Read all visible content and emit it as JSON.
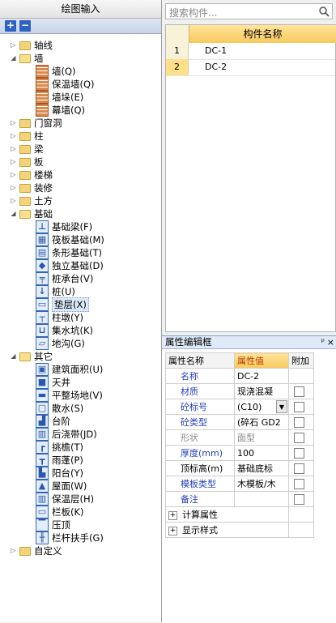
{
  "left_panel": {
    "title": "绘图输入",
    "toolbar": {
      "expand": "+",
      "collapse": "−"
    },
    "tree": [
      {
        "label": "轴线",
        "level": 0,
        "kind": "folder",
        "expanded": false
      },
      {
        "label": "墙",
        "level": 0,
        "kind": "folder",
        "expanded": true
      },
      {
        "label": "墙(Q)",
        "level": 1,
        "kind": "item",
        "icon": "wall-icon"
      },
      {
        "label": "保温墙(Q)",
        "level": 1,
        "kind": "item",
        "icon": "insulation-wall-icon"
      },
      {
        "label": "墙垛(E)",
        "level": 1,
        "kind": "item",
        "icon": "wall-pier-icon"
      },
      {
        "label": "幕墙(Q)",
        "level": 1,
        "kind": "item",
        "icon": "curtain-wall-icon"
      },
      {
        "label": "门窗洞",
        "level": 0,
        "kind": "folder",
        "expanded": false
      },
      {
        "label": "柱",
        "level": 0,
        "kind": "folder",
        "expanded": false
      },
      {
        "label": "梁",
        "level": 0,
        "kind": "folder",
        "expanded": false
      },
      {
        "label": "板",
        "level": 0,
        "kind": "folder",
        "expanded": false
      },
      {
        "label": "楼梯",
        "level": 0,
        "kind": "folder",
        "expanded": false
      },
      {
        "label": "装修",
        "level": 0,
        "kind": "folder",
        "expanded": false
      },
      {
        "label": "土方",
        "level": 0,
        "kind": "folder",
        "expanded": false
      },
      {
        "label": "基础",
        "level": 0,
        "kind": "folder",
        "expanded": true
      },
      {
        "label": "基础梁(F)",
        "level": 1,
        "kind": "item",
        "icon": "foundation-beam-icon"
      },
      {
        "label": "筏板基础(M)",
        "level": 1,
        "kind": "item",
        "icon": "raft-foundation-icon"
      },
      {
        "label": "条形基础(T)",
        "level": 1,
        "kind": "item",
        "icon": "strip-foundation-icon"
      },
      {
        "label": "独立基础(D)",
        "level": 1,
        "kind": "item",
        "icon": "isolated-foundation-icon"
      },
      {
        "label": "桩承台(V)",
        "level": 1,
        "kind": "item",
        "icon": "pile-cap-icon"
      },
      {
        "label": "桩(U)",
        "level": 1,
        "kind": "item",
        "icon": "pile-icon"
      },
      {
        "label": "垫层(X)",
        "level": 1,
        "kind": "item",
        "icon": "cushion-layer-icon",
        "selected": true
      },
      {
        "label": "柱墩(Y)",
        "level": 1,
        "kind": "item",
        "icon": "column-pier-icon"
      },
      {
        "label": "集水坑(K)",
        "level": 1,
        "kind": "item",
        "icon": "sump-pit-icon"
      },
      {
        "label": "地沟(G)",
        "level": 1,
        "kind": "item",
        "icon": "trench-icon"
      },
      {
        "label": "其它",
        "level": 0,
        "kind": "folder",
        "expanded": true
      },
      {
        "label": "建筑面积(U)",
        "level": 1,
        "kind": "item",
        "icon": "building-area-icon"
      },
      {
        "label": "天井",
        "level": 1,
        "kind": "item",
        "icon": "patio-icon"
      },
      {
        "label": "平整场地(V)",
        "level": 1,
        "kind": "item",
        "icon": "site-leveling-icon"
      },
      {
        "label": "散水(S)",
        "level": 1,
        "kind": "item",
        "icon": "apron-icon"
      },
      {
        "label": "台阶",
        "level": 1,
        "kind": "item",
        "icon": "steps-icon"
      },
      {
        "label": "后浇带(JD)",
        "level": 1,
        "kind": "item",
        "icon": "post-pour-strip-icon"
      },
      {
        "label": "挑檐(T)",
        "level": 1,
        "kind": "item",
        "icon": "eave-icon"
      },
      {
        "label": "雨蓬(P)",
        "level": 1,
        "kind": "item",
        "icon": "canopy-icon"
      },
      {
        "label": "阳台(Y)",
        "level": 1,
        "kind": "item",
        "icon": "balcony-icon"
      },
      {
        "label": "屋面(W)",
        "level": 1,
        "kind": "item",
        "icon": "roof-icon"
      },
      {
        "label": "保温层(H)",
        "level": 1,
        "kind": "item",
        "icon": "insulation-layer-icon"
      },
      {
        "label": "栏板(K)",
        "level": 1,
        "kind": "item",
        "icon": "parapet-icon"
      },
      {
        "label": "压顶",
        "level": 1,
        "kind": "item",
        "icon": "coping-icon"
      },
      {
        "label": "栏杆扶手(G)",
        "level": 1,
        "kind": "item",
        "icon": "handrail-icon"
      },
      {
        "label": "自定义",
        "level": 0,
        "kind": "folder",
        "expanded": false
      }
    ]
  },
  "search": {
    "placeholder": "搜索构件..."
  },
  "component_list": {
    "header": "构件名称",
    "rows": [
      {
        "num": "1",
        "name": "DC-1",
        "selected": false
      },
      {
        "num": "2",
        "name": "DC-2",
        "selected": true
      }
    ]
  },
  "property_editor": {
    "title": "属性编辑框",
    "pin": "ᵖ",
    "close": "×",
    "headers": {
      "name": "属性名称",
      "value": "属性值",
      "add": "附加"
    },
    "rows": [
      {
        "name": "名称",
        "value": "DC-2",
        "color": "blue",
        "checkbox": false
      },
      {
        "name": "材质",
        "value": "现浇混凝",
        "color": "blue",
        "checkbox": true
      },
      {
        "name": "砼标号",
        "value": "(C10)",
        "color": "blue",
        "checkbox": true,
        "dropdown": true
      },
      {
        "name": "砼类型",
        "value": "(碎石 GD2",
        "color": "blue",
        "checkbox": true
      },
      {
        "name": "形状",
        "value": "面型",
        "color": "gray",
        "checkbox": true
      },
      {
        "name": "厚度(mm)",
        "value": "100",
        "color": "blue",
        "checkbox": true
      },
      {
        "name": "顶标高(m)",
        "value": "基础底标",
        "color": "black",
        "checkbox": true
      },
      {
        "name": "模板类型",
        "value": "木模板/木",
        "color": "blue",
        "checkbox": true
      },
      {
        "name": "备注",
        "value": "",
        "color": "blue",
        "checkbox": true
      }
    ],
    "groups": [
      "计算属性",
      "显示样式"
    ]
  },
  "colors": {
    "accent": "#f9c95e",
    "link": "#2440c0",
    "header_bg": "#dfe9f8"
  }
}
